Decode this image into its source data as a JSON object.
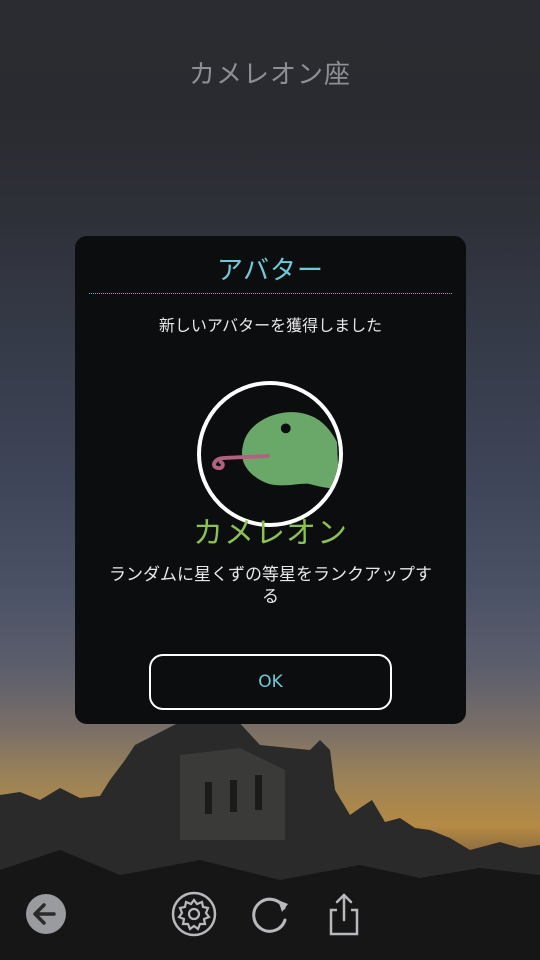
{
  "header": {
    "title": "カメレオン座"
  },
  "dialog": {
    "title": "アバター",
    "message": "新しいアバターを獲得しました",
    "avatar_icon": "chameleon-avatar-icon",
    "avatar_name": "カメレオン",
    "description": "ランダムに星くずの等星をランクアップする",
    "ok_label": "OK"
  },
  "toolbar": {
    "items": [
      {
        "icon": "back-arrow-icon"
      },
      {
        "icon": "gear-icon"
      },
      {
        "icon": "refresh-icon"
      },
      {
        "icon": "share-icon"
      }
    ]
  },
  "colors": {
    "accent_cyan": "#6fc9d8",
    "avatar_green": "#8cc152",
    "dialog_bg": "#0c0d0f"
  }
}
